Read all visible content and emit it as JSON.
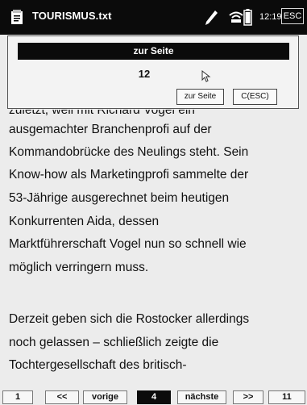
{
  "titlebar": {
    "title": "TOURISMUS.txt",
    "clock": "12:19",
    "esc": "ESC"
  },
  "dialog": {
    "title": "zur Seite",
    "value": "12",
    "goto_label": "zur Seite",
    "cancel_label": "C(ESC)"
  },
  "content": {
    "cut_line": "zuletzt, weil mit Richard Vogel ein",
    "lines": [
      "ausgemachter Branchenprofi auf der",
      "Kommandobrücke des Neulings steht. Sein",
      "Know-how als Marketingprofi sammelte der",
      "53-Jährige ausgerechnet beim heutigen",
      "Konkurrenten Aida, dessen",
      "Marktführerschaft Vogel nun so schnell wie",
      "möglich verringern muss.",
      "Derzeit geben sich die Rostocker allerdings",
      "noch gelassen – schließlich zeigte die",
      "Tochtergesellschaft des britisch-"
    ]
  },
  "pager": {
    "first": "1",
    "rewind": "<<",
    "prev": "vorige",
    "current": "4",
    "next": "nächste",
    "forward": ">>",
    "last": "11"
  }
}
